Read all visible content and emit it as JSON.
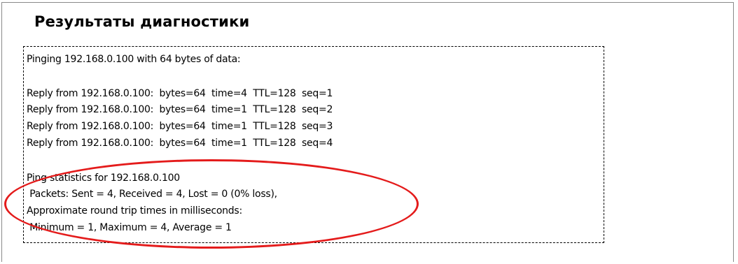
{
  "page": {
    "title": "Результаты диагностики"
  },
  "diagnostics": {
    "lines": [
      "Pinging 192.168.0.100 with 64 bytes of data:",
      "Reply from 192.168.0.100:  bytes=64  time=4  TTL=128  seq=1",
      "Reply from 192.168.0.100:  bytes=64  time=1  TTL=128  seq=2",
      "Reply from 192.168.0.100:  bytes=64  time=1  TTL=128  seq=3",
      "Reply from 192.168.0.100:  bytes=64  time=1  TTL=128  seq=4",
      "Ping statistics for 192.168.0.100",
      " Packets: Sent = 4, Received = 4, Lost = 0 (0% loss),",
      "Approximate round trip times in milliseconds:",
      " Minimum = 1, Maximum = 4, Average = 1"
    ]
  },
  "colors": {
    "highlight": "#e41b1b",
    "border": "#8a8a8a"
  }
}
